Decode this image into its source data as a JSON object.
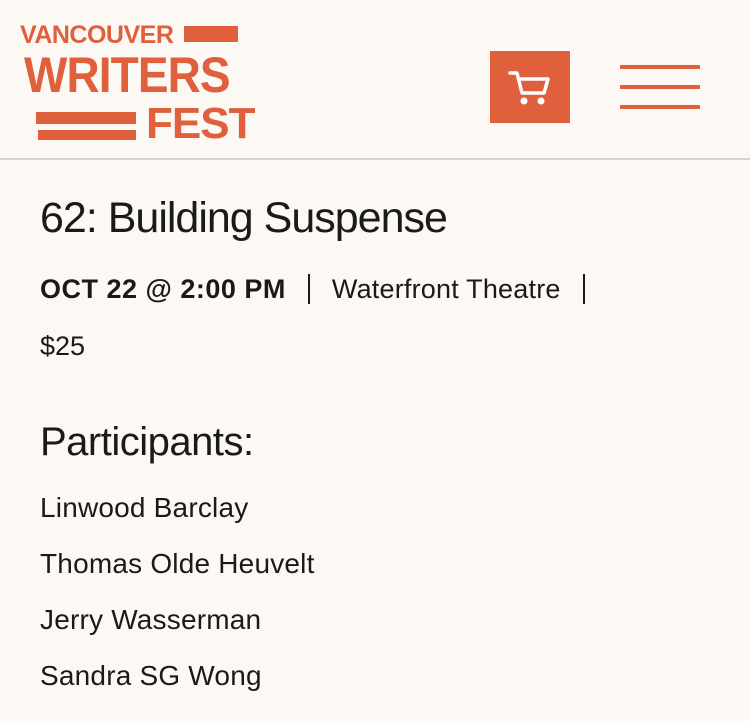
{
  "header": {
    "logo": {
      "line1": "VANCOUVER",
      "line2": "WRITERS",
      "line3": "FEST"
    },
    "cart_icon": "shopping-cart-icon",
    "menu_icon": "hamburger-menu-icon"
  },
  "event": {
    "title": "62: Building Suspense",
    "date": "OCT 22 @ 2:00 PM",
    "venue": "Waterfront Theatre",
    "price": "$25"
  },
  "participants": {
    "heading": "Participants:",
    "names": [
      "Linwood Barclay",
      "Thomas Olde Heuvelt",
      "Jerry Wasserman",
      "Sandra SG Wong"
    ]
  },
  "colors": {
    "accent": "#e0603d",
    "background": "#fcf8f3",
    "text": "#1a1a1a",
    "divider": "#d6d3cf"
  }
}
